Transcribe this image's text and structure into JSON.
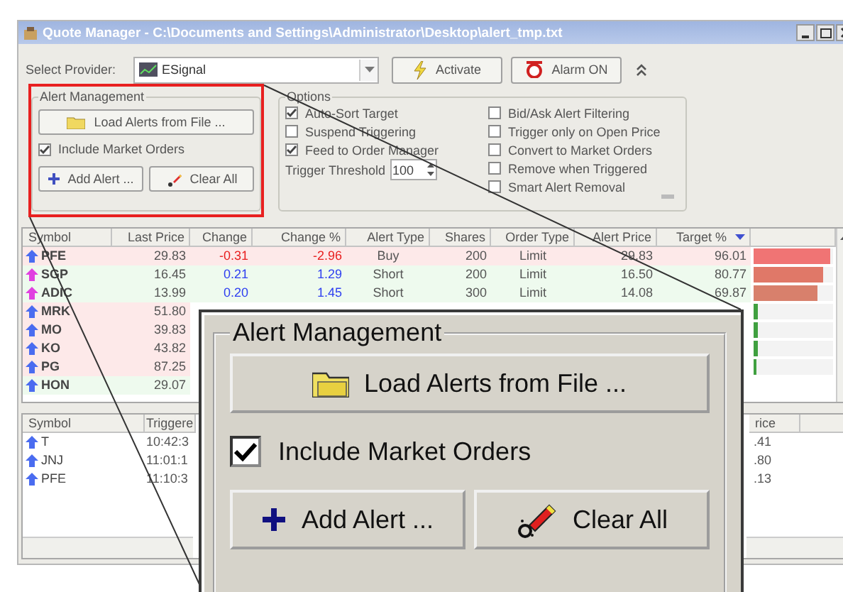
{
  "window": {
    "title": "Quote Manager - C:\\Documents and Settings\\Administrator\\Desktop\\alert_tmp.txt"
  },
  "toolbar": {
    "provider_label": "Select Provider:",
    "provider": "ESignal",
    "activate_button": "Activate",
    "alarm_button": "Alarm ON"
  },
  "alert_management": {
    "title": "Alert Management",
    "load_button": "Load Alerts from File ...",
    "include_market_orders": {
      "label": "Include Market Orders",
      "checked": true
    },
    "add_button": "Add Alert ...",
    "clear_button": "Clear All"
  },
  "options": {
    "title": "Options",
    "left_checkboxes": [
      {
        "label": "Auto-Sort Target",
        "checked": true
      },
      {
        "label": "Suspend Triggering",
        "checked": false
      },
      {
        "label": "Feed to Order Manager",
        "checked": true
      }
    ],
    "threshold_label": "Trigger Threshold",
    "threshold": "100",
    "right_checkboxes": [
      {
        "label": "Bid/Ask Alert Filtering",
        "checked": false
      },
      {
        "label": "Trigger only on Open Price",
        "checked": false
      },
      {
        "label": "Convert to Market Orders",
        "checked": false
      },
      {
        "label": "Remove when Triggered",
        "checked": false
      },
      {
        "label": "Smart Alert Removal",
        "checked": false
      }
    ]
  },
  "alerts_table": {
    "columns": [
      "Symbol",
      "Last Price",
      "Change",
      "Change %",
      "Alert Type",
      "Shares",
      "Order Type",
      "Alert Price",
      "Target %"
    ],
    "rows": [
      {
        "symbol": "PFE",
        "icon": {
          "color": "#4a6cf0"
        },
        "color": "#fde9e9",
        "last": "29.83",
        "change": "-0.31",
        "change_pct": "-2.96",
        "negative": true,
        "alert_type": "Buy",
        "shares": "200",
        "order_type": "Limit",
        "alert_price": "29.83",
        "target": "96.01",
        "bar": {
          "level": 0.97,
          "color": "#f07474"
        }
      },
      {
        "symbol": "SGP",
        "icon": {
          "color": "#e040e0"
        },
        "color": "#eefaee",
        "last": "16.45",
        "change": "0.21",
        "change_pct": "1.29",
        "negative": false,
        "alert_type": "Short",
        "shares": "200",
        "order_type": "Limit",
        "alert_price": "16.50",
        "target": "80.77",
        "bar": {
          "level": 0.88,
          "color": "#e07868"
        }
      },
      {
        "symbol": "ADIC",
        "icon": {
          "color": "#e040e0"
        },
        "color": "#eefaee",
        "last": "13.99",
        "change": "0.20",
        "change_pct": "1.45",
        "negative": false,
        "alert_type": "Short",
        "shares": "300",
        "order_type": "Limit",
        "alert_price": "14.08",
        "target": "69.87",
        "bar": {
          "level": 0.8,
          "color": "#d8806c"
        }
      },
      {
        "symbol": "MRK",
        "icon": {
          "color": "#4a6cf0"
        },
        "color": "#fde9e9",
        "last": "51.80",
        "bar": {
          "level": 0.06,
          "color": "#40a040"
        }
      },
      {
        "symbol": "MO",
        "icon": {
          "color": "#4a6cf0"
        },
        "color": "#fde9e9",
        "last": "39.83",
        "bar": {
          "level": 0.05,
          "color": "#40a040"
        }
      },
      {
        "symbol": "KO",
        "icon": {
          "color": "#4a6cf0"
        },
        "color": "#fde9e9",
        "last": "43.82",
        "bar": {
          "level": 0.05,
          "color": "#40a040"
        }
      },
      {
        "symbol": "PG",
        "icon": {
          "color": "#4a6cf0"
        },
        "color": "#fde9e9",
        "last": "87.25",
        "bar": {
          "level": 0.04,
          "color": "#40a040"
        }
      },
      {
        "symbol": "HON",
        "icon": {
          "color": "#4a6cf0"
        },
        "color": "#eefaee",
        "last": "29.07"
      }
    ]
  },
  "triggered_table": {
    "columns": [
      "Symbol",
      "Triggere",
      "rice"
    ],
    "rows": [
      {
        "symbol": "T",
        "icon": {
          "color": "#4a6cf0"
        },
        "time": "10:42:3",
        "price": ".41"
      },
      {
        "symbol": "JNJ",
        "icon": {
          "color": "#4a6cf0"
        },
        "time": "11:01:1",
        "price": ".80"
      },
      {
        "symbol": "PFE",
        "icon": {
          "color": "#4a6cf0"
        },
        "time": "11:10:3",
        "price": ".13"
      }
    ]
  },
  "callout": {
    "title": "Alert Management",
    "load_button": "Load Alerts from File ...",
    "include_market_orders": {
      "label": "Include Market Orders",
      "checked": true
    },
    "add_button": "Add Alert ...",
    "clear_button": "Clear All"
  }
}
